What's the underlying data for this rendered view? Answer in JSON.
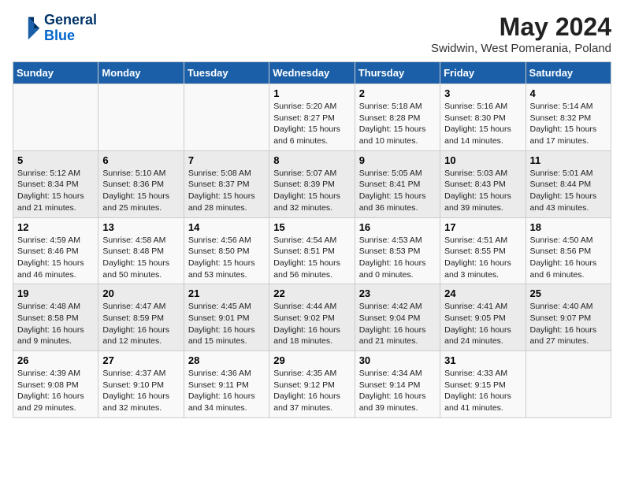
{
  "header": {
    "logo_line1": "General",
    "logo_line2": "Blue",
    "month": "May 2024",
    "location": "Swidwin, West Pomerania, Poland"
  },
  "weekdays": [
    "Sunday",
    "Monday",
    "Tuesday",
    "Wednesday",
    "Thursday",
    "Friday",
    "Saturday"
  ],
  "weeks": [
    [
      {
        "day": "",
        "info": ""
      },
      {
        "day": "",
        "info": ""
      },
      {
        "day": "",
        "info": ""
      },
      {
        "day": "1",
        "info": "Sunrise: 5:20 AM\nSunset: 8:27 PM\nDaylight: 15 hours\nand 6 minutes."
      },
      {
        "day": "2",
        "info": "Sunrise: 5:18 AM\nSunset: 8:28 PM\nDaylight: 15 hours\nand 10 minutes."
      },
      {
        "day": "3",
        "info": "Sunrise: 5:16 AM\nSunset: 8:30 PM\nDaylight: 15 hours\nand 14 minutes."
      },
      {
        "day": "4",
        "info": "Sunrise: 5:14 AM\nSunset: 8:32 PM\nDaylight: 15 hours\nand 17 minutes."
      }
    ],
    [
      {
        "day": "5",
        "info": "Sunrise: 5:12 AM\nSunset: 8:34 PM\nDaylight: 15 hours\nand 21 minutes."
      },
      {
        "day": "6",
        "info": "Sunrise: 5:10 AM\nSunset: 8:36 PM\nDaylight: 15 hours\nand 25 minutes."
      },
      {
        "day": "7",
        "info": "Sunrise: 5:08 AM\nSunset: 8:37 PM\nDaylight: 15 hours\nand 28 minutes."
      },
      {
        "day": "8",
        "info": "Sunrise: 5:07 AM\nSunset: 8:39 PM\nDaylight: 15 hours\nand 32 minutes."
      },
      {
        "day": "9",
        "info": "Sunrise: 5:05 AM\nSunset: 8:41 PM\nDaylight: 15 hours\nand 36 minutes."
      },
      {
        "day": "10",
        "info": "Sunrise: 5:03 AM\nSunset: 8:43 PM\nDaylight: 15 hours\nand 39 minutes."
      },
      {
        "day": "11",
        "info": "Sunrise: 5:01 AM\nSunset: 8:44 PM\nDaylight: 15 hours\nand 43 minutes."
      }
    ],
    [
      {
        "day": "12",
        "info": "Sunrise: 4:59 AM\nSunset: 8:46 PM\nDaylight: 15 hours\nand 46 minutes."
      },
      {
        "day": "13",
        "info": "Sunrise: 4:58 AM\nSunset: 8:48 PM\nDaylight: 15 hours\nand 50 minutes."
      },
      {
        "day": "14",
        "info": "Sunrise: 4:56 AM\nSunset: 8:50 PM\nDaylight: 15 hours\nand 53 minutes."
      },
      {
        "day": "15",
        "info": "Sunrise: 4:54 AM\nSunset: 8:51 PM\nDaylight: 15 hours\nand 56 minutes."
      },
      {
        "day": "16",
        "info": "Sunrise: 4:53 AM\nSunset: 8:53 PM\nDaylight: 16 hours\nand 0 minutes."
      },
      {
        "day": "17",
        "info": "Sunrise: 4:51 AM\nSunset: 8:55 PM\nDaylight: 16 hours\nand 3 minutes."
      },
      {
        "day": "18",
        "info": "Sunrise: 4:50 AM\nSunset: 8:56 PM\nDaylight: 16 hours\nand 6 minutes."
      }
    ],
    [
      {
        "day": "19",
        "info": "Sunrise: 4:48 AM\nSunset: 8:58 PM\nDaylight: 16 hours\nand 9 minutes."
      },
      {
        "day": "20",
        "info": "Sunrise: 4:47 AM\nSunset: 8:59 PM\nDaylight: 16 hours\nand 12 minutes."
      },
      {
        "day": "21",
        "info": "Sunrise: 4:45 AM\nSunset: 9:01 PM\nDaylight: 16 hours\nand 15 minutes."
      },
      {
        "day": "22",
        "info": "Sunrise: 4:44 AM\nSunset: 9:02 PM\nDaylight: 16 hours\nand 18 minutes."
      },
      {
        "day": "23",
        "info": "Sunrise: 4:42 AM\nSunset: 9:04 PM\nDaylight: 16 hours\nand 21 minutes."
      },
      {
        "day": "24",
        "info": "Sunrise: 4:41 AM\nSunset: 9:05 PM\nDaylight: 16 hours\nand 24 minutes."
      },
      {
        "day": "25",
        "info": "Sunrise: 4:40 AM\nSunset: 9:07 PM\nDaylight: 16 hours\nand 27 minutes."
      }
    ],
    [
      {
        "day": "26",
        "info": "Sunrise: 4:39 AM\nSunset: 9:08 PM\nDaylight: 16 hours\nand 29 minutes."
      },
      {
        "day": "27",
        "info": "Sunrise: 4:37 AM\nSunset: 9:10 PM\nDaylight: 16 hours\nand 32 minutes."
      },
      {
        "day": "28",
        "info": "Sunrise: 4:36 AM\nSunset: 9:11 PM\nDaylight: 16 hours\nand 34 minutes."
      },
      {
        "day": "29",
        "info": "Sunrise: 4:35 AM\nSunset: 9:12 PM\nDaylight: 16 hours\nand 37 minutes."
      },
      {
        "day": "30",
        "info": "Sunrise: 4:34 AM\nSunset: 9:14 PM\nDaylight: 16 hours\nand 39 minutes."
      },
      {
        "day": "31",
        "info": "Sunrise: 4:33 AM\nSunset: 9:15 PM\nDaylight: 16 hours\nand 41 minutes."
      },
      {
        "day": "",
        "info": ""
      }
    ]
  ]
}
